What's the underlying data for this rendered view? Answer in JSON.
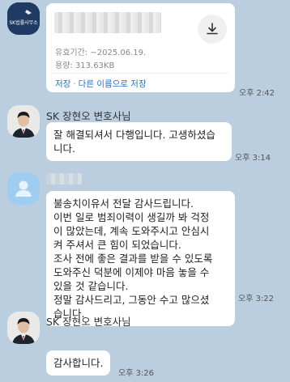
{
  "file_message": {
    "expiry": "유효기간: ~2025.06.19.",
    "size": "용량: 313.63KB",
    "save_label": "저장",
    "separator": "·",
    "save_as_label": "다른 이름으로 저장",
    "time": "오후 2:42",
    "sender_logo_text": "SK법률사무소"
  },
  "messages": [
    {
      "sender": "SK 장현오 변호사님",
      "lines": [
        "잘 해결되셔서 다행입니다. 고생하셨습",
        "니다."
      ],
      "time": "오후 3:14"
    },
    {
      "sender": "",
      "lines": [
        "불송치이유서 전달 감사드립니다.",
        "이번 일로 범죄이력이 생길까 봐 걱정",
        "이 많았는데, 계속 도와주시고 안심시",
        "켜 주셔서 큰 힘이 되었습니다.",
        "조사 전에 좋은 결과를 받을 수 있도록",
        "도와주신 덕분에 이제야 마음 놓을 수",
        "있을 것 같습니다.",
        "정말 감사드리고, 그동안 수고 많으셨",
        "습니다."
      ],
      "time": "오후 3:22"
    },
    {
      "sender": "SK 장현오 변호사님",
      "lines": [
        "감사합니다."
      ],
      "time": "오후 3:26"
    }
  ],
  "colors": {
    "background": "#bacee0",
    "bubble": "#ffffff",
    "link": "#2a6fc9",
    "logo_avatar": "#1f3a63"
  }
}
